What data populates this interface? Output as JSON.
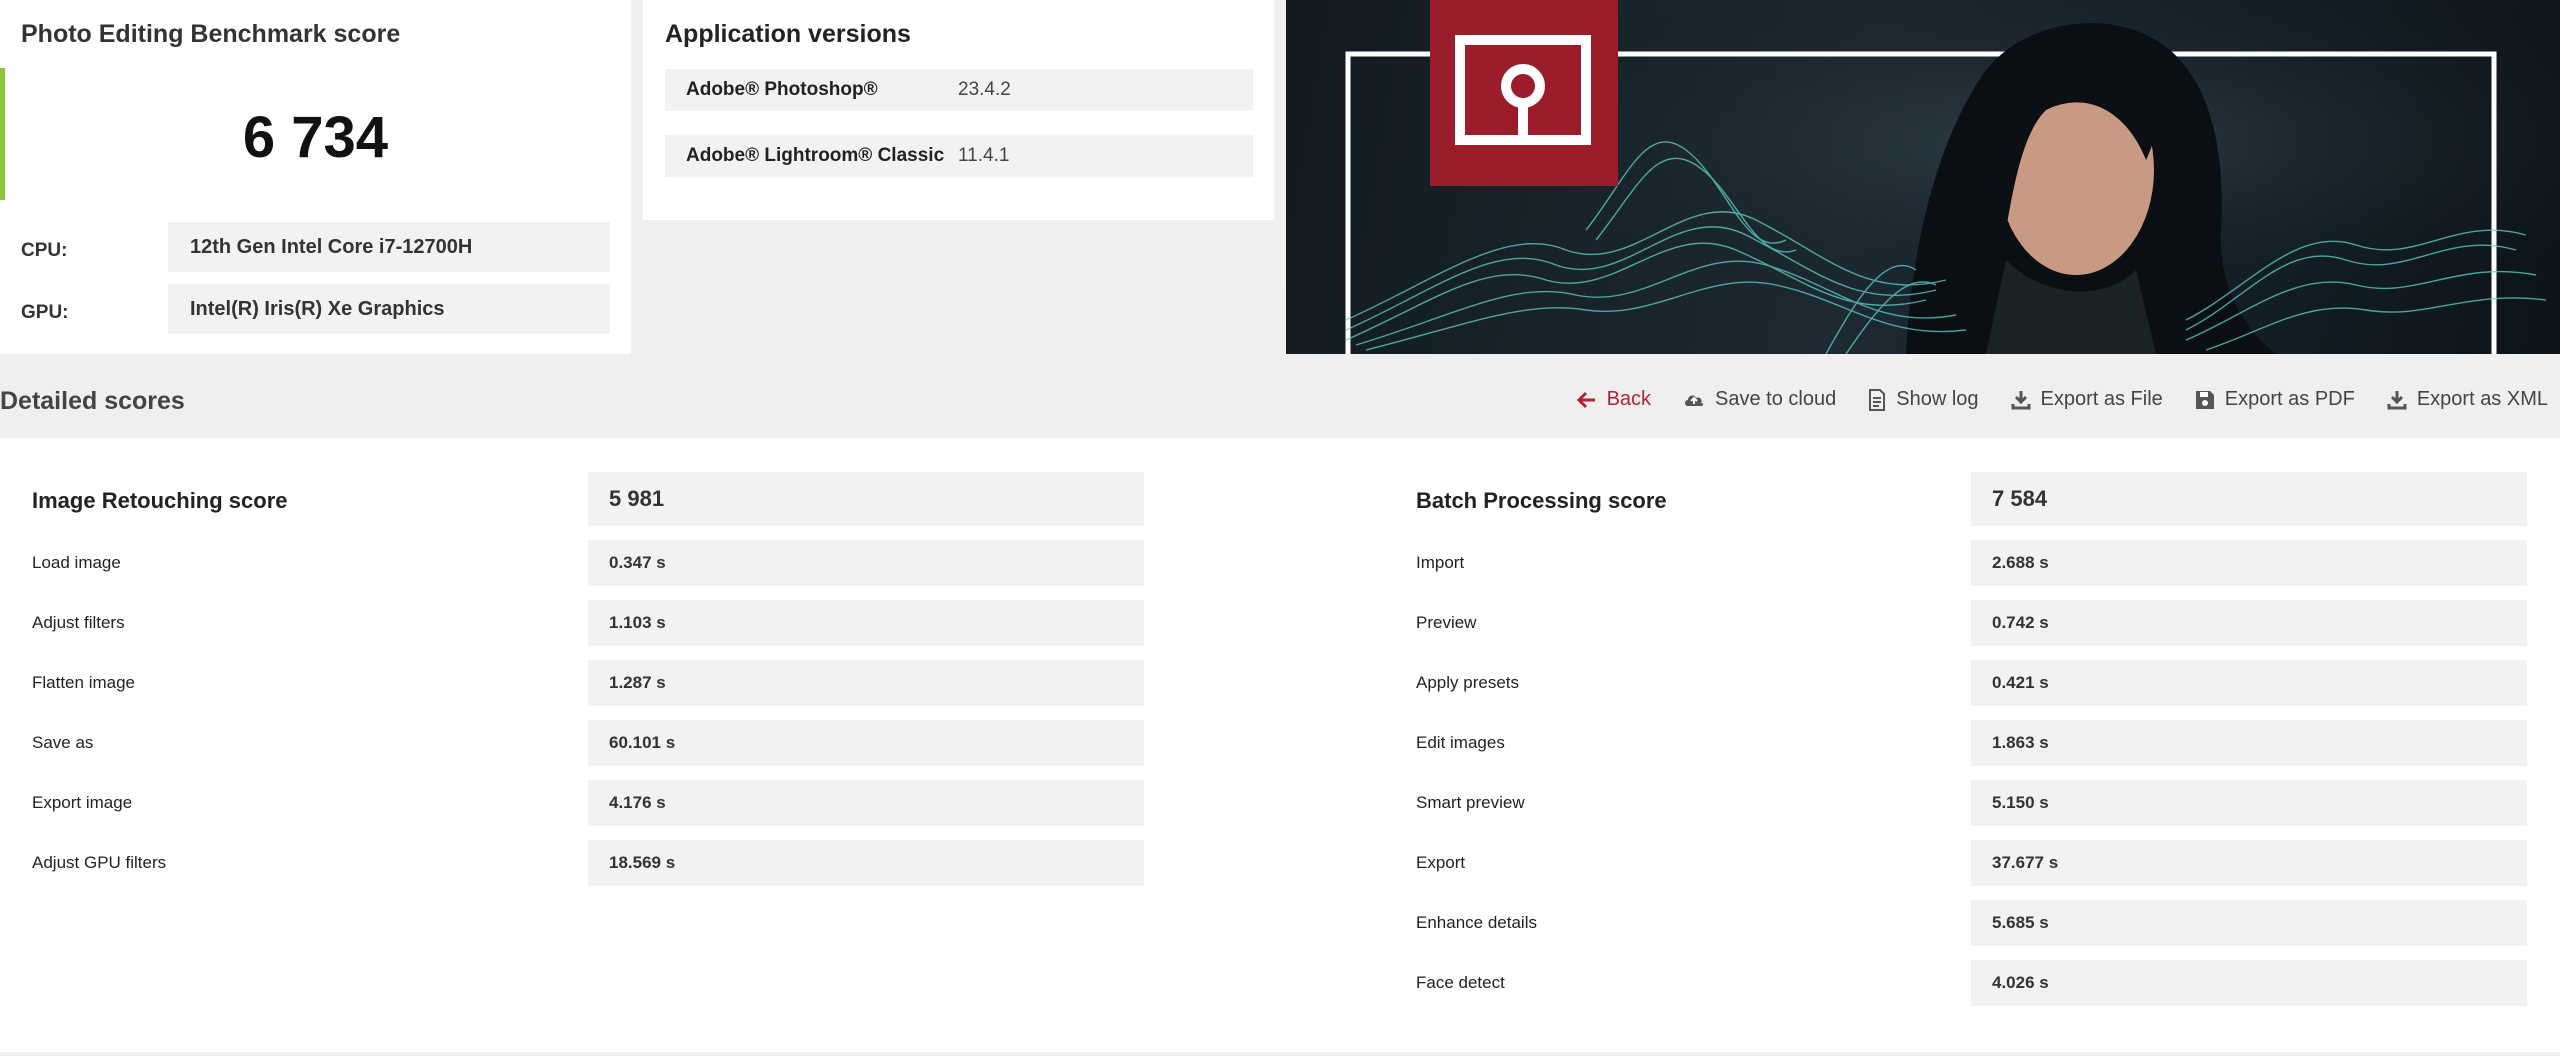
{
  "score_panel": {
    "title": "Photo Editing Benchmark score",
    "score": "6 734",
    "cpu_label": "CPU:",
    "cpu_value": "12th Gen Intel Core i7-12700H",
    "gpu_label": "GPU:",
    "gpu_value": "Intel(R) Iris(R) Xe Graphics",
    "accent_color": "#8cc63f"
  },
  "app_versions": {
    "title": "Application versions",
    "apps": [
      {
        "name": "Adobe® Photoshop®",
        "version": "23.4.2"
      },
      {
        "name": "Adobe® Lightroom® Classic",
        "version": "11.4.1"
      }
    ]
  },
  "hero": {
    "logo_color": "#9b1c2a",
    "logo_icon": "procyon-logo-icon"
  },
  "detailed": {
    "title": "Detailed scores",
    "actions": [
      {
        "label": "Back",
        "icon": "arrow-left-icon",
        "color": "#b32433"
      },
      {
        "label": "Save to cloud",
        "icon": "cloud-upload-icon"
      },
      {
        "label": "Show log",
        "icon": "document-icon"
      },
      {
        "label": "Export as File",
        "icon": "download-icon"
      },
      {
        "label": "Export as PDF",
        "icon": "floppy-icon"
      },
      {
        "label": "Export as XML",
        "icon": "download-icon"
      }
    ],
    "image_retouching": {
      "title": "Image Retouching score",
      "score": "5 981",
      "rows": [
        {
          "label": "Load image",
          "value": "0.347 s"
        },
        {
          "label": "Adjust filters",
          "value": "1.103 s"
        },
        {
          "label": "Flatten image",
          "value": "1.287 s"
        },
        {
          "label": "Save as",
          "value": "60.101 s"
        },
        {
          "label": "Export image",
          "value": "4.176 s"
        },
        {
          "label": "Adjust GPU filters",
          "value": "18.569 s"
        }
      ]
    },
    "batch_processing": {
      "title": "Batch Processing score",
      "score": "7 584",
      "rows": [
        {
          "label": "Import",
          "value": "2.688 s"
        },
        {
          "label": "Preview",
          "value": "0.742 s"
        },
        {
          "label": "Apply presets",
          "value": "0.421 s"
        },
        {
          "label": "Edit images",
          "value": "1.863 s"
        },
        {
          "label": "Smart preview",
          "value": "5.150 s"
        },
        {
          "label": "Export",
          "value": "37.677 s"
        },
        {
          "label": "Enhance details",
          "value": "5.685 s"
        },
        {
          "label": "Face detect",
          "value": "4.026 s"
        }
      ]
    }
  }
}
